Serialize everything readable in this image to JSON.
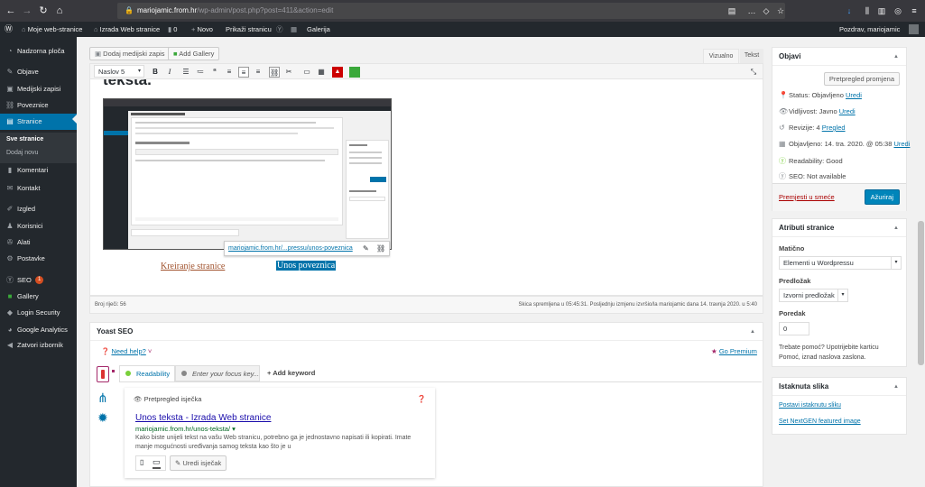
{
  "browser": {
    "url_host": "mariojamic.from.hr",
    "url_path": "/wp-admin/post.php?post=411&action=edit"
  },
  "adminbar": {
    "site": "Moje web-stranice",
    "site2": "Izrada Web stranice",
    "comments": "0",
    "new": "Novo",
    "view": "Prikaži stranicu",
    "gallery": "Galerija",
    "greeting": "Pozdrav, mariojamic"
  },
  "sidebar": {
    "items": [
      {
        "label": "Nadzorna ploča",
        "icon": "dashboard-icon"
      },
      {
        "label": "Objave",
        "icon": "pin-icon"
      },
      {
        "label": "Medijski zapisi",
        "icon": "media-icon"
      },
      {
        "label": "Poveznice",
        "icon": "link-icon"
      },
      {
        "label": "Stranice",
        "icon": "page-icon"
      },
      {
        "label": "Komentari",
        "icon": "comment-icon"
      },
      {
        "label": "Kontakt",
        "icon": "mail-icon"
      },
      {
        "label": "Izgled",
        "icon": "brush-icon"
      },
      {
        "label": "Korisnici",
        "icon": "users-icon"
      },
      {
        "label": "Alati",
        "icon": "wrench-icon"
      },
      {
        "label": "Postavke",
        "icon": "settings-icon"
      },
      {
        "label": "SEO",
        "icon": "seo-icon",
        "badge": "1"
      },
      {
        "label": "Gallery",
        "icon": "gallery-icon"
      },
      {
        "label": "Login Security",
        "icon": "shield-icon"
      },
      {
        "label": "Google Analytics",
        "icon": "analytics-icon"
      },
      {
        "label": "Zatvori izbornik",
        "icon": "collapse-icon"
      }
    ],
    "sub": [
      "Sve stranice",
      "Dodaj novu"
    ]
  },
  "editor": {
    "add_media": "Dodaj medijski zapis",
    "add_gallery": "Add Gallery",
    "tab_visual": "Vizualno",
    "tab_text": "Tekst",
    "format": "Naslov 5",
    "heading_fragment": "teksta.",
    "link1": "Kreiranje stranice",
    "link2": "Unos poveznica",
    "link_popup": "mariojamic.from.hr/...pressu/unos-poveznica",
    "word_count": "Broj riječi: 56",
    "saved": "Skica spremljena u 05:45:31. Posljednju izmjenu izvršio/la mariojamic dana 14. travnja 2020. u 5:40"
  },
  "yoast": {
    "title": "Yoast SEO",
    "help": "Need help?",
    "premium": "Go Premium",
    "tab_readability": "Readability",
    "focus_placeholder": "Enter your focus key...",
    "add_keyword": "Add keyword",
    "preview_title": "Pretpregled isječka",
    "snippet_title": "Unos teksta - Izrada Web stranice",
    "snippet_url": "mariojamic.from.hr/unos-teksta/",
    "snippet_desc1": "Kako biste unijeli tekst na vašu Web stranicu, potrebno ga je jednostavno napisati ili kopirati. Imate",
    "snippet_desc2": "manje mogućnosti uređivanja samog teksta kao što je u",
    "edit_snippet": "Uredi isječak"
  },
  "publish": {
    "title": "Objavi",
    "preview": "Pretpregled promjena",
    "status_label": "Status:",
    "status": "Objavljeno",
    "visibility_label": "Vidljivost:",
    "visibility": "Javno",
    "revisions_label": "Revizije:",
    "revisions": "4",
    "revisions_link": "Pregled",
    "published_label": "Objavljeno:",
    "published": "14. tra. 2020. @ 05:38",
    "edit": "Uredi",
    "readability": "Readability: Good",
    "seo": "SEO: Not available",
    "trash": "Premjesti u smeće",
    "update": "Ažuriraj"
  },
  "attributes": {
    "title": "Atributi stranice",
    "parent_label": "Matično",
    "parent_value": "Elementi u Wordpressu",
    "template_label": "Predložak",
    "template_value": "Izvorni predložak",
    "order_label": "Poredak",
    "order_value": "0",
    "help1": "Trebate pomoć? Upotrijebite karticu",
    "help2": "Pomoć, iznad naslova zaslona."
  },
  "featured": {
    "title": "Istaknuta slika",
    "set": "Postavi istaknutu sliku",
    "nextgen": "Set NextGEN featured image"
  },
  "colors": {
    "accent": "#0073aa",
    "admin_dark": "#23282d",
    "good": "#7ad03a",
    "premium": "#a4286a"
  }
}
